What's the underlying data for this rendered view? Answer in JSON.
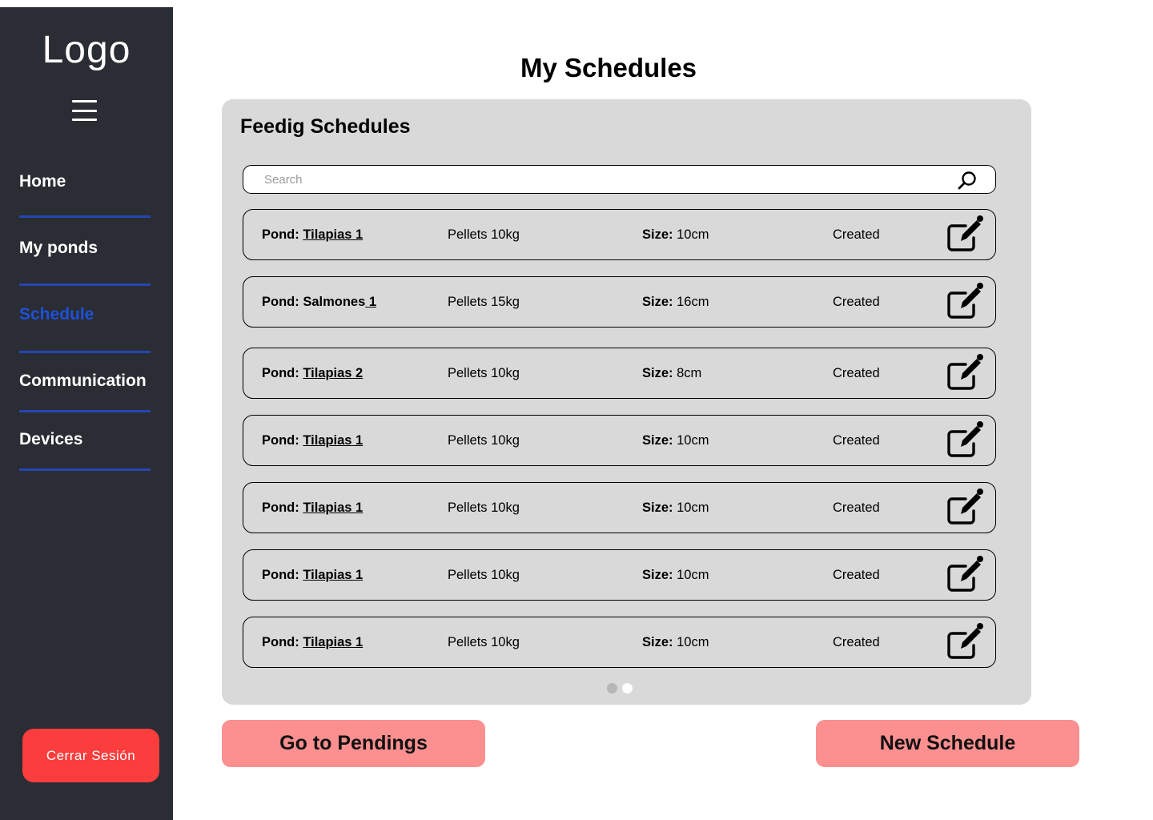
{
  "sidebar": {
    "logo": "Logo",
    "menu_icon": "hamburger-menu-icon",
    "nav": [
      {
        "label": "Home",
        "active": false
      },
      {
        "label": "My ponds",
        "active": false
      },
      {
        "label": "Schedule",
        "active": true
      },
      {
        "label": "Communication",
        "active": false
      },
      {
        "label": "Devices",
        "active": false
      }
    ],
    "logout_label": "Cerrar Sesión"
  },
  "page": {
    "title": "My Schedules"
  },
  "panel": {
    "title": "Feedig Schedules",
    "search_placeholder": "Search",
    "search_value": "",
    "search_icon": "search-icon",
    "rows": [
      {
        "pond_prefix": "Pond: ",
        "pond_name": "Tilapias 1",
        "feed": "Pellets 10kg",
        "size_label": "Size:",
        "size_value": " 10cm",
        "status": "Created"
      },
      {
        "pond_prefix": "Pond: Salmones",
        "pond_name": " 1",
        "feed": "Pellets 15kg",
        "size_label": "Size:",
        "size_value": " 16cm",
        "status": "Created"
      },
      {
        "pond_prefix": "Pond: ",
        "pond_name": "Tilapias 2",
        "feed": "Pellets 10kg",
        "size_label": "Size:",
        "size_value": " 8cm",
        "status": "Created"
      },
      {
        "pond_prefix": "Pond: ",
        "pond_name": "Tilapias 1",
        "feed": "Pellets 10kg",
        "size_label": "Size:",
        "size_value": " 10cm",
        "status": "Created"
      },
      {
        "pond_prefix": "Pond: ",
        "pond_name": "Tilapias 1",
        "feed": "Pellets 10kg",
        "size_label": "Size:",
        "size_value": " 10cm",
        "status": "Created"
      },
      {
        "pond_prefix": "Pond: ",
        "pond_name": "Tilapias 1",
        "feed": "Pellets 10kg",
        "size_label": "Size:",
        "size_value": " 10cm",
        "status": "Created"
      },
      {
        "pond_prefix": "Pond: ",
        "pond_name": "Tilapias 1",
        "feed": "Pellets 10kg",
        "size_label": "Size:",
        "size_value": " 10cm",
        "status": "Created"
      }
    ],
    "edit_icon": "edit-icon",
    "pagination": {
      "total_pages": 2,
      "current_page": 2
    }
  },
  "actions": {
    "pendings_label": "Go to Pendings",
    "new_label": "New Schedule"
  },
  "colors": {
    "sidebar_bg": "#2a2d33",
    "active_nav": "#1e50d8",
    "nav_divider": "#2447b4",
    "logout_bg": "#fc3d3d",
    "panel_bg": "#d9d9d9",
    "action_bg": "#fc8f8f"
  }
}
